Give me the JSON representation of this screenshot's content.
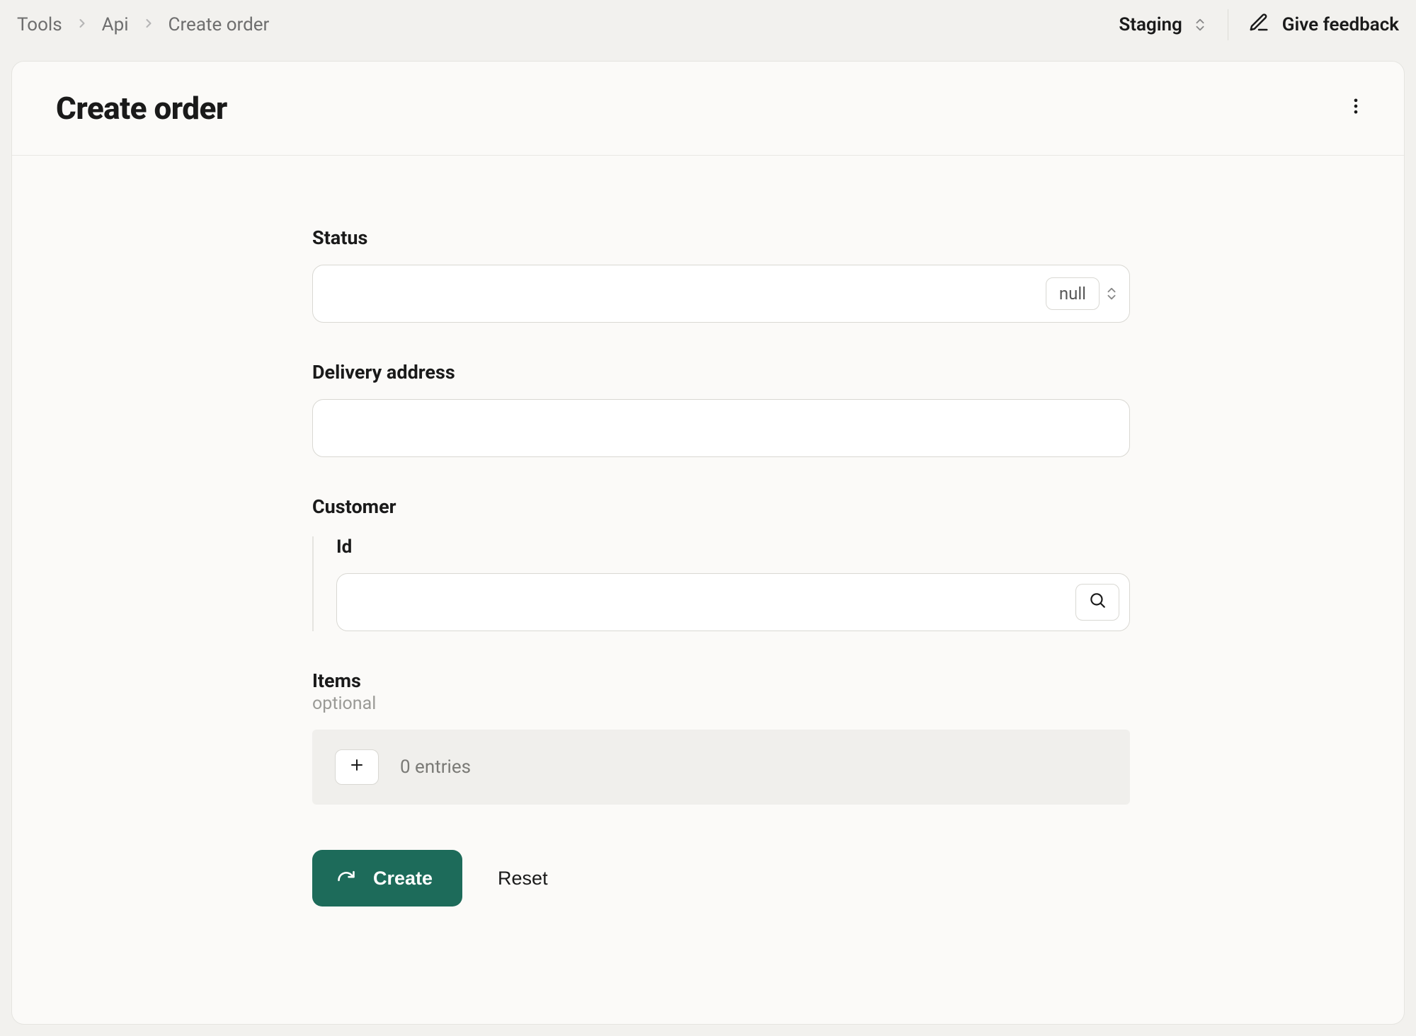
{
  "topbar": {
    "breadcrumbs": [
      "Tools",
      "Api",
      "Create order"
    ],
    "environment": "Staging",
    "feedback_label": "Give feedback"
  },
  "page": {
    "title": "Create order"
  },
  "form": {
    "status": {
      "label": "Status",
      "value": "",
      "type_badge": "null"
    },
    "delivery_address": {
      "label": "Delivery address",
      "value": ""
    },
    "customer": {
      "label": "Customer",
      "id": {
        "label": "Id",
        "value": ""
      }
    },
    "items": {
      "label": "Items",
      "sublabel": "optional",
      "entries_text": "0 entries"
    },
    "actions": {
      "submit": "Create",
      "reset": "Reset"
    }
  }
}
